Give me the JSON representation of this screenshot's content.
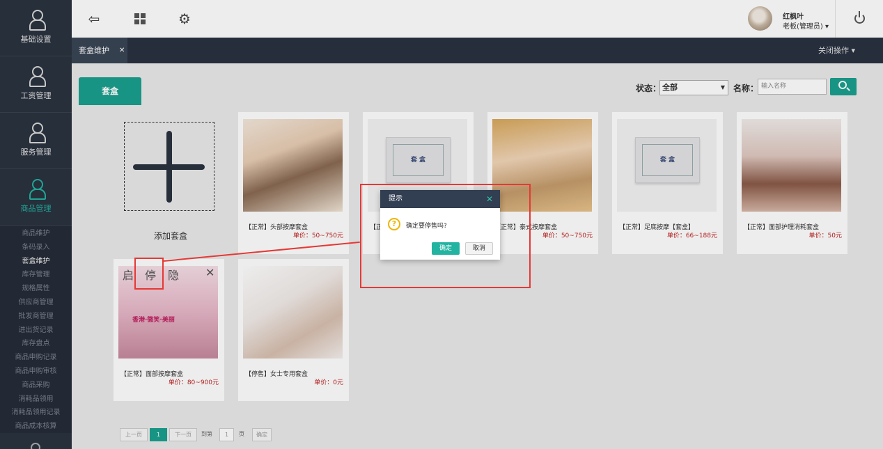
{
  "sidebar": {
    "main": [
      {
        "label": "基础设置",
        "icon": "person-icon"
      },
      {
        "label": "工资管理",
        "icon": "person-icon"
      },
      {
        "label": "服务管理",
        "icon": "person-icon"
      },
      {
        "label": "商品管理",
        "icon": "person-icon"
      }
    ],
    "sub": [
      "商品维护",
      "条码录入",
      "套盒维护",
      "库存管理",
      "规格属性",
      "供应商管理",
      "批发商管理",
      "进出货记录",
      "库存盘点",
      "商品申购记录",
      "商品申购审核",
      "商品采购",
      "消耗品领用",
      "消耗品领用记录",
      "商品成本核算"
    ]
  },
  "topbar": {
    "user_name": "红枫叶",
    "user_role": "老板(管理员) ▾"
  },
  "tabs": {
    "active_label": "套盒维护",
    "close_ops": "关闭操作 ▾"
  },
  "content": {
    "category_tab": "套盒",
    "filter": {
      "status_label": "状态：",
      "status_value": "全部",
      "name_label": "名称：",
      "name_placeholder": "输入名称"
    },
    "add_label": "添加套盒",
    "box_text": "套 盒",
    "cards": [
      {
        "title": "【正常】头部按摩套盒",
        "price": "单价：50~750元"
      },
      {
        "title": "【正",
        "price": ""
      },
      {
        "title": "【正常】泰式按摩套盒",
        "price": "单价：50~750元"
      },
      {
        "title": "【正常】足底按摩【套盒】",
        "price": "单价：66~188元"
      },
      {
        "title": "【正常】面部护理消耗套盒",
        "price": "单价：50元"
      },
      {
        "title": "【正常】面部按摩套盒",
        "price": "单价：80~900元"
      },
      {
        "title": "【停售】女士专用套盒",
        "price": "单价：0元"
      }
    ],
    "card_controls": {
      "enable": "启",
      "stop": "停",
      "hide": "隐",
      "delete": "✕"
    },
    "poster_text": "香港·微笑·美丽"
  },
  "dialog": {
    "title": "提示",
    "close": "✕",
    "message": "确定要停售吗?",
    "ok": "确定",
    "cancel": "取消"
  },
  "pager": {
    "prev": "上一页",
    "page": "1",
    "next": "下一页",
    "goto": "到第",
    "page_input": "1",
    "page_unit": "页",
    "confirm": "确定"
  }
}
